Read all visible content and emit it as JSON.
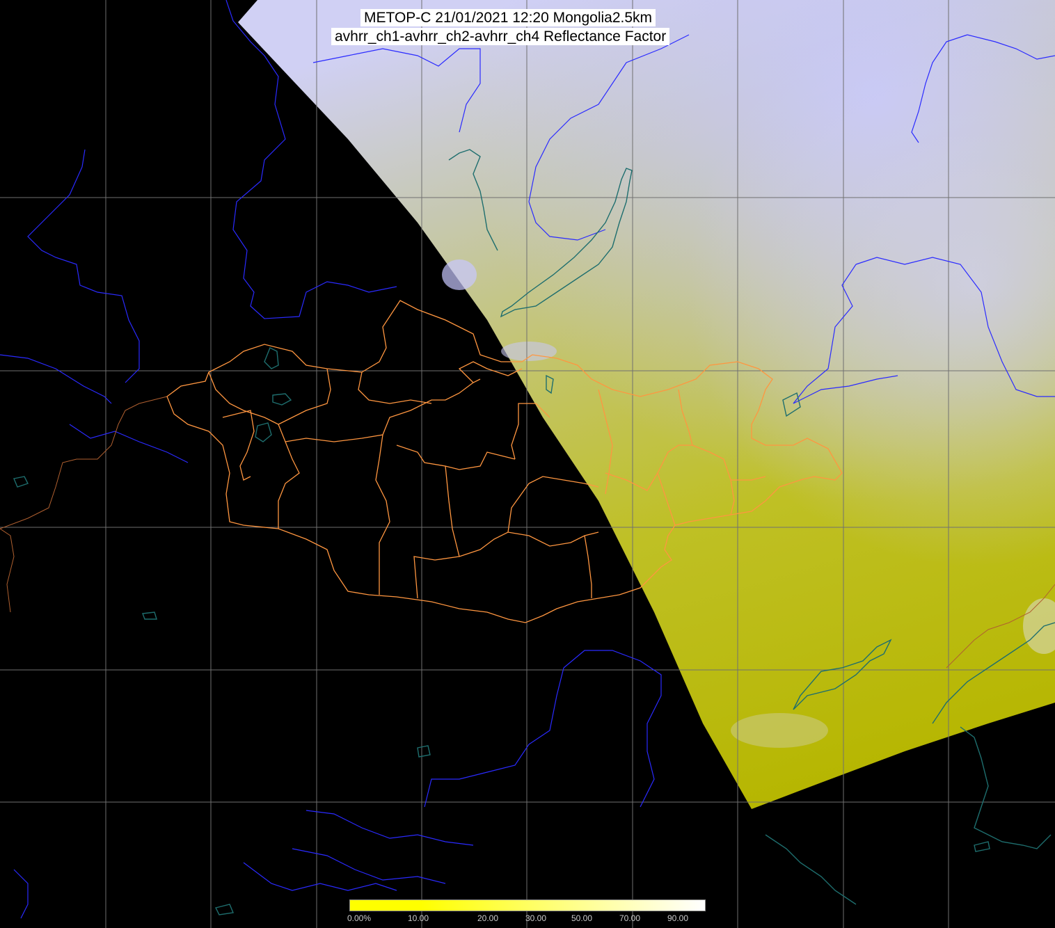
{
  "title": {
    "line1": "METOP-C 21/01/2021 12:20 Mongolia2.5km",
    "line2": "avhrr_ch1-avhrr_ch2-avhrr_ch4 Reflectance Factor"
  },
  "colorbar": {
    "unit": "%",
    "tick_labels": [
      "0.00%",
      "10.00",
      "20.00",
      "30.00",
      "50.00",
      "70.00",
      "90.00"
    ],
    "colors": [
      "#ffff00",
      "#ffff00",
      "#ffff40",
      "#ffff80",
      "#ffffc0",
      "#ffffff"
    ]
  },
  "colors": {
    "swath_light": "#c8c8f0",
    "swath_mid": "#c8c87a",
    "swath_yellow": "#b8b800",
    "grid": "#707070",
    "rivers": "#2a2aff",
    "coast": "#1e6e6e",
    "admin_borders": "#ff9640",
    "background": "#000000"
  }
}
